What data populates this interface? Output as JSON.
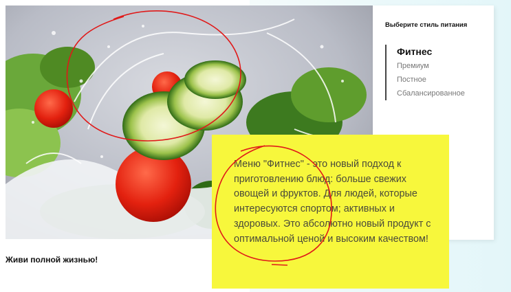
{
  "sidebar": {
    "title": "Выберите стиль питания",
    "items": [
      {
        "label": "Фитнес",
        "active": true
      },
      {
        "label": "Премиум",
        "active": false
      },
      {
        "label": "Постное",
        "active": false
      },
      {
        "label": "Сбалансированное",
        "active": false
      }
    ]
  },
  "hero": {
    "alt": "salad"
  },
  "tagline": "Живи полной жизнью!",
  "description": {
    "text": "Меню \"Фитнес\" - это новый подход к приготовлению блюд: больше свежих овощей и фруктов. Для людей, которые интересуются спортом; активных и здоровых. Это абсолютно новый продукт с оптимальной ценой и высоким качеством!"
  },
  "colors": {
    "highlight": "#f7f73c",
    "annotation": "#e01919",
    "accent_bar": "#444444"
  }
}
